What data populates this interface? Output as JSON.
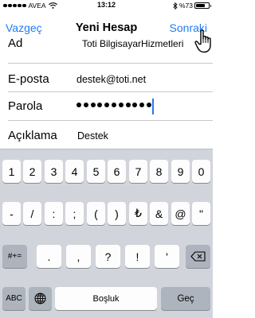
{
  "status_bar": {
    "carrier": "AVEA",
    "time": "13:12",
    "battery": "%73",
    "battery_level": 0.73
  },
  "nav": {
    "cancel_label": "Vazgeç",
    "title": "Yeni Hesap",
    "next_label": "Sonraki"
  },
  "form": {
    "rows": [
      {
        "label": "Ad",
        "value": "Toti BilgisayarHizmetleri"
      },
      {
        "label": "E-posta",
        "value": "destek@toti.net"
      },
      {
        "label": "Parola",
        "password_length": 11
      },
      {
        "label": "Açıklama",
        "value": "Destek"
      }
    ]
  },
  "keyboard": {
    "row1": [
      "1",
      "2",
      "3",
      "4",
      "5",
      "6",
      "7",
      "8",
      "9",
      "0"
    ],
    "row2": [
      "-",
      "/",
      ":",
      ";",
      "(",
      ")",
      "₺",
      "&",
      "@",
      "\""
    ],
    "row3_left": "#+=",
    "row3": [
      ".",
      ",",
      "?",
      "!",
      "'"
    ],
    "abc_label": "ABC",
    "space_label": "Boşluk",
    "go_label": "Geç"
  },
  "colors": {
    "accent": "#1f7cf5",
    "keyboard_bg": "#d1d5db",
    "key_light": "#fdfdfd",
    "key_dark": "#aeb4bd"
  }
}
